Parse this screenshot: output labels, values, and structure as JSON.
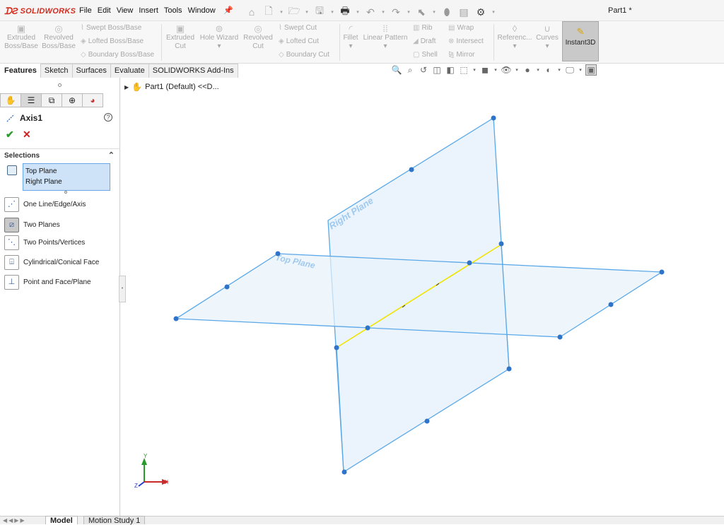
{
  "app": {
    "brand": "SOLIDWORKS",
    "document_title": "Part1 *"
  },
  "menu": [
    "File",
    "Edit",
    "View",
    "Insert",
    "Tools",
    "Window"
  ],
  "ribbon": {
    "extruded_boss": [
      "Extruded",
      "Boss/Base"
    ],
    "revolved_boss": [
      "Revolved",
      "Boss/Base"
    ],
    "swept_boss": "Swept Boss/Base",
    "lofted_boss": "Lofted Boss/Base",
    "boundary_boss": "Boundary Boss/Base",
    "extruded_cut": [
      "Extruded",
      "Cut"
    ],
    "hole_wizard": "Hole Wizard",
    "revolved_cut": [
      "Revolved",
      "Cut"
    ],
    "swept_cut": "Swept Cut",
    "lofted_cut": "Lofted Cut",
    "boundary_cut": "Boundary Cut",
    "fillet": "Fillet",
    "linear_pattern": "Linear Pattern",
    "rib": "Rib",
    "draft": "Draft",
    "shell": "Shell",
    "wrap": "Wrap",
    "intersect": "Intersect",
    "mirror": "Mirror",
    "reference": "Referenc...",
    "curves": "Curves",
    "instant3d": "Instant3D"
  },
  "tabs": [
    "Features",
    "Sketch",
    "Surfaces",
    "Evaluate",
    "SOLIDWORKS Add-Ins"
  ],
  "tree": {
    "root": "Part1 (Default) <<D..."
  },
  "property_manager": {
    "title": "Axis1",
    "selections_header": "Selections",
    "selected_items": [
      "Top Plane",
      "Right Plane"
    ],
    "options": [
      {
        "label": "One Line/Edge/Axis",
        "icon": "line-axis-icon"
      },
      {
        "label": "Two Planes",
        "icon": "two-planes-icon"
      },
      {
        "label": "Two Points/Vertices",
        "icon": "two-points-icon"
      },
      {
        "label": "Cylindrical/Conical Face",
        "icon": "cylinder-face-icon"
      },
      {
        "label": "Point and Face/Plane",
        "icon": "point-face-icon"
      }
    ]
  },
  "viewport": {
    "right_plane_label": "Right Plane",
    "top_plane_label": "Top Plane",
    "triad": {
      "x": "X",
      "y": "Y",
      "z": "Z"
    }
  },
  "bottom_tabs": [
    "Model",
    "Motion Study 1"
  ],
  "colors": {
    "plane_edge": "#5aa8e8",
    "plane_fill": "#e7f2fb",
    "axis": "#f0e400",
    "brand": "#d52b1e",
    "handle": "#2f74c8"
  }
}
